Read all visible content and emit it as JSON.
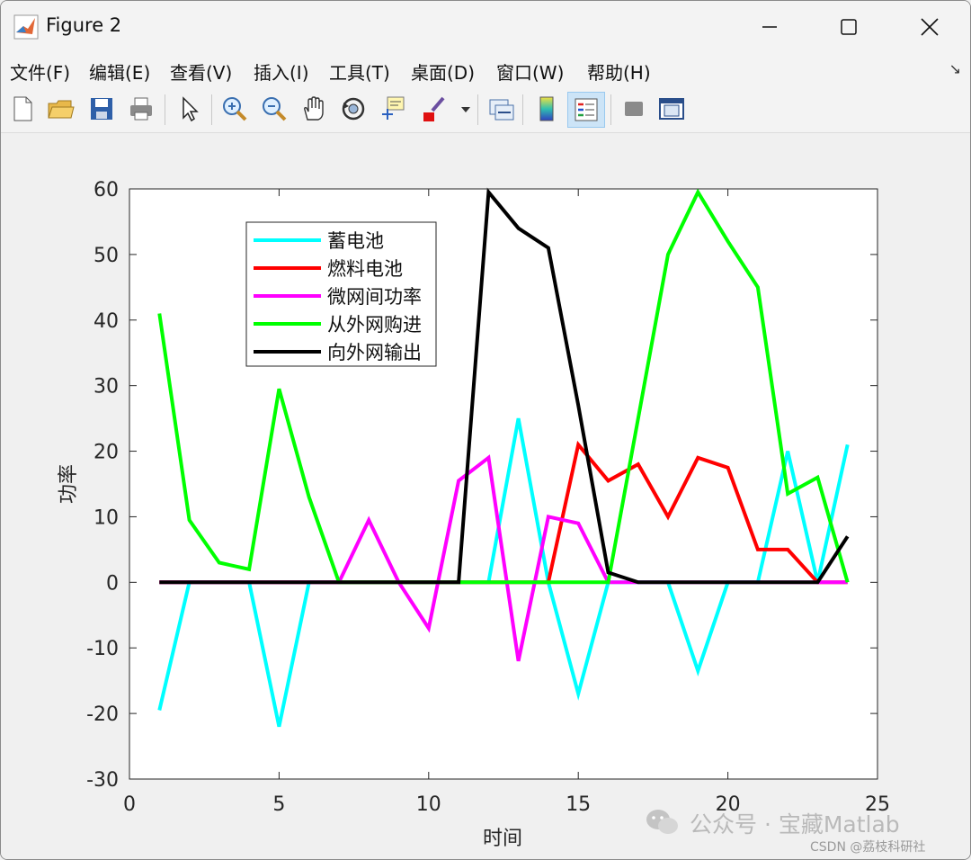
{
  "window": {
    "title": "Figure 2"
  },
  "menu": {
    "items": [
      "文件(F)",
      "编辑(E)",
      "查看(V)",
      "插入(I)",
      "工具(T)",
      "桌面(D)",
      "窗口(W)",
      "帮助(H)"
    ]
  },
  "toolbar": {
    "icons": [
      "new-file-icon",
      "open-folder-icon",
      "save-icon",
      "print-icon",
      "pointer-icon",
      "zoom-in-icon",
      "zoom-out-icon",
      "pan-hand-icon",
      "rotate-3d-icon",
      "data-cursor-icon",
      "brush-icon",
      "dropdown-arrow-icon",
      "link-plot-icon",
      "colorbar-icon",
      "legend-icon",
      "hide-plot-tools-icon",
      "show-plot-tools-icon"
    ]
  },
  "watermark": {
    "brand": "公众号 · 宝藏Matlab",
    "credit": "CSDN @荔枝科研社"
  },
  "colors": {
    "cyan": "#00ffff",
    "red": "#ff0000",
    "magenta": "#ff00ff",
    "green": "#00ff00",
    "black": "#000000"
  },
  "chart_data": {
    "type": "line",
    "title": "",
    "xlabel": "时间",
    "ylabel": "功率",
    "xlim": [
      0,
      25
    ],
    "ylim": [
      -30,
      60
    ],
    "xticks": [
      0,
      5,
      10,
      15,
      20,
      25
    ],
    "yticks": [
      -30,
      -20,
      -10,
      0,
      10,
      20,
      30,
      40,
      50,
      60
    ],
    "grid": false,
    "legend_position": "top-left inside",
    "x": [
      1,
      2,
      3,
      4,
      5,
      6,
      7,
      8,
      9,
      10,
      11,
      12,
      13,
      14,
      15,
      16,
      17,
      18,
      19,
      20,
      21,
      22,
      23,
      24
    ],
    "series": [
      {
        "name": "蓄电池",
        "color": "#00ffff",
        "values": [
          -19.5,
          0,
          0,
          0,
          -22,
          0,
          0,
          0,
          0,
          0,
          0,
          0,
          25,
          0,
          -17,
          0,
          0,
          0,
          -13.5,
          0,
          0,
          20,
          0,
          21
        ]
      },
      {
        "name": "燃料电池",
        "color": "#ff0000",
        "values": [
          0,
          0,
          0,
          0,
          0,
          0,
          0,
          0,
          0,
          0,
          0,
          0,
          0,
          0,
          21,
          15.5,
          18,
          10,
          19,
          17.5,
          5,
          5,
          0,
          0
        ]
      },
      {
        "name": "微网间功率",
        "color": "#ff00ff",
        "values": [
          0,
          0,
          0,
          0,
          0,
          0,
          0,
          9.5,
          0,
          -7,
          15.5,
          19,
          -12,
          10,
          9,
          0,
          0,
          0,
          0,
          0,
          0,
          0,
          0,
          0
        ]
      },
      {
        "name": "从外网购进",
        "color": "#00ff00",
        "values": [
          41,
          9.5,
          3,
          2,
          29.5,
          13,
          0,
          0,
          0,
          0,
          0,
          0,
          0,
          0,
          0,
          0,
          25,
          50,
          59.5,
          52,
          45,
          13.5,
          16,
          0
        ]
      },
      {
        "name": "向外网输出",
        "color": "#000000",
        "values": [
          0,
          0,
          0,
          0,
          0,
          0,
          0,
          0,
          0,
          0,
          0,
          59.5,
          54,
          51,
          27,
          1.5,
          0,
          0,
          0,
          0,
          0,
          0,
          0,
          7
        ]
      }
    ]
  }
}
